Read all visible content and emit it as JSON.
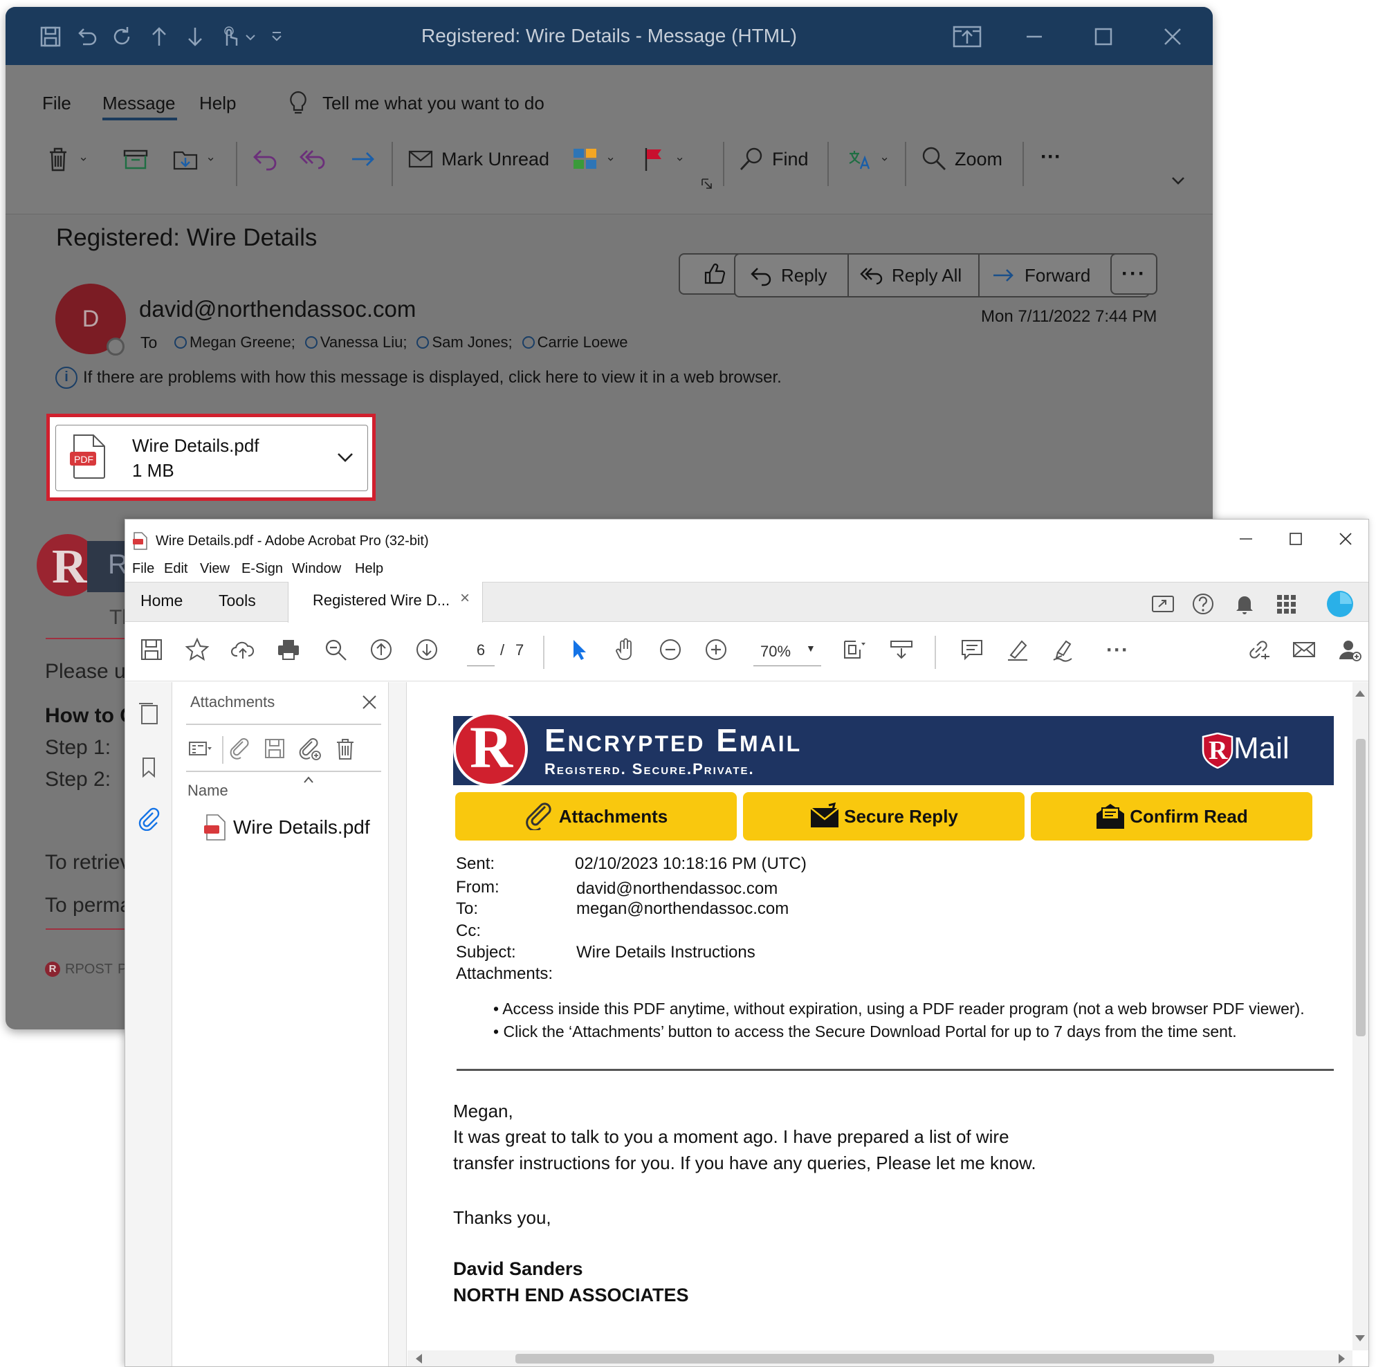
{
  "outlook": {
    "window_title": "Registered: Wire Details - Message (HTML)",
    "menu": {
      "file": "File",
      "message": "Message",
      "help": "Help",
      "tell_me": "Tell me what you want to do"
    },
    "ribbon": {
      "mark_unread": "Mark Unread",
      "find": "Find",
      "zoom": "Zoom",
      "more": "···"
    },
    "subject": "Registered: Wire Details",
    "sender": "david@northendassoc.com",
    "avatar_letter": "D",
    "to_label": "To",
    "recipients": [
      "Megan Greene;",
      "Vanessa Liu;",
      "Sam Jones;",
      "Carrie Loewe"
    ],
    "actions": {
      "reply": "Reply",
      "reply_all": "Reply All",
      "forward": "Forward"
    },
    "date": "Mon 7/11/2022 7:44 PM",
    "info_bar": "If there are problems with how this message is displayed, click here to view it in a web browser.",
    "attachment": {
      "name": "Wire Details.pdf",
      "size": "1 MB",
      "icon_text": "PDF"
    },
    "body_fragments": {
      "banner_r": "R",
      "banner_text": "R",
      "line1": "Th",
      "line2": "Please u",
      "line3": "How to C",
      "step1": "Step 1:",
      "step2": "Step 2:",
      "line4": "To retriev",
      "line5": "To perma",
      "footer": "RPOST",
      "footer_tail": "P"
    },
    "colors": {
      "titlebar": "#1b3a5c",
      "highlight": "#d0202e"
    }
  },
  "acrobat": {
    "window_title": "Wire Details.pdf - Adobe Acrobat Pro (32-bit)",
    "menu": [
      "File",
      "Edit",
      "View",
      "E-Sign",
      "Window",
      "Help"
    ],
    "tabs": {
      "home": "Home",
      "tools": "Tools",
      "doc": "Registered Wire D...",
      "close": "×"
    },
    "page_current": "6",
    "page_sep": "/",
    "page_total": "7",
    "zoom": "70%",
    "panel": {
      "title": "Attachments",
      "column": "Name",
      "file": "Wire Details.pdf"
    },
    "pdf": {
      "banner_title": "Encrypted Email",
      "banner_sub": "Registerd. Secure.Private.",
      "brand": "Mail",
      "brand_r": "R",
      "buttons": {
        "attachments": "Attachments",
        "secure_reply": "Secure Reply",
        "confirm_read": "Confirm Read"
      },
      "fields": [
        {
          "label": "Sent:",
          "value": "02/10/2023 10:18:16 PM (UTC)"
        },
        {
          "label": "From:",
          "value": "david@northendassoc.com"
        },
        {
          "label": "To:",
          "value": "megan@northendassoc.com"
        },
        {
          "label": "Cc:",
          "value": ""
        },
        {
          "label": "Subject:",
          "value": "Wire Details Instructions"
        },
        {
          "label": "Attachments:",
          "value": ""
        }
      ],
      "bullets": [
        "Access inside this PDF anytime, without expiration, using a PDF reader program (not a web browser PDF viewer).",
        "Click the ‘Attachments’ button to access the Secure Download Portal for up to 7 days from the time sent."
      ],
      "greeting": "Megan,",
      "body1": "It was great to talk to you a moment ago. I have prepared a list of wire",
      "body2": "transfer instructions for you. If you have any queries, Please let me know.",
      "closing": "Thanks you,",
      "sig_name": "David Sanders",
      "sig_company": "NORTH END ASSOCIATES"
    },
    "colors": {
      "banner": "#1e3462",
      "button": "#f9c80e",
      "accent": "#1473e6"
    }
  }
}
